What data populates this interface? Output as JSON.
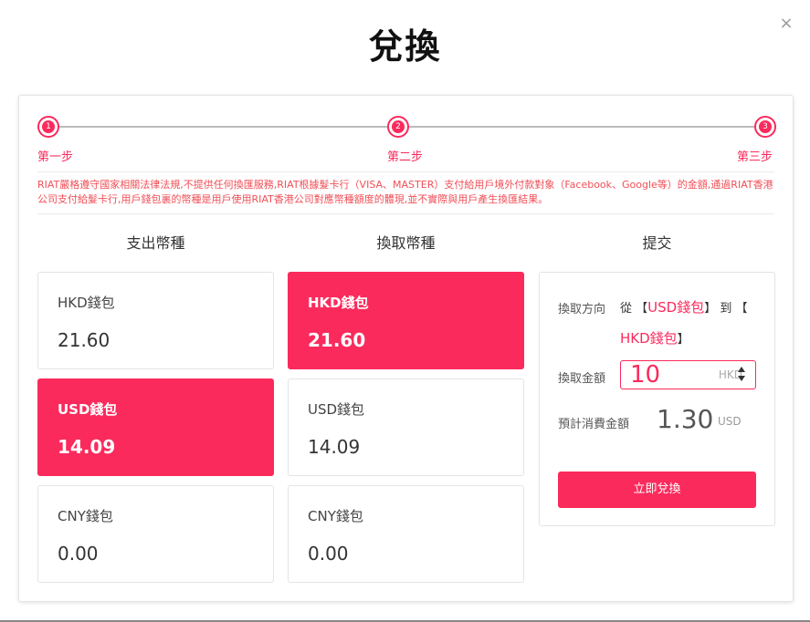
{
  "dialog": {
    "title": "兌換",
    "close_label": "×"
  },
  "stepper": {
    "steps": [
      {
        "number": "1",
        "label": "第一步"
      },
      {
        "number": "2",
        "label": "第二步"
      },
      {
        "number": "3",
        "label": "第三步"
      }
    ]
  },
  "notice": "RIAT嚴格遵守國家相關法律法規,不提供任何換匯服務,RIAT根據髮卡行（VISA、MASTER）支付給用戶境外付款對象（Facebook、Google等）的金額,通過RIAT香港公司支付給髮卡行,用戶錢包裏的幣種是用戶使用RIAT香港公司對應幣種額度的體現,並不實際與用戶產生換匯結果。",
  "columns": {
    "pay_title": "支出幣種",
    "receive_title": "換取幣種",
    "submit_title": "提交"
  },
  "pay_wallets": [
    {
      "name": "HKD錢包",
      "balance": "21.60",
      "selected": false
    },
    {
      "name": "USD錢包",
      "balance": "14.09",
      "selected": true
    },
    {
      "name": "CNY錢包",
      "balance": "0.00",
      "selected": false
    }
  ],
  "receive_wallets": [
    {
      "name": "HKD錢包",
      "balance": "21.60",
      "selected": true
    },
    {
      "name": "USD錢包",
      "balance": "14.09",
      "selected": false
    },
    {
      "name": "CNY錢包",
      "balance": "0.00",
      "selected": false
    }
  ],
  "submit": {
    "direction_label": "換取方向",
    "from_word": "從",
    "from_wallet": "USD錢包",
    "to_word": "到",
    "to_wallet": "HKD錢包",
    "bracket_open": "【",
    "bracket_close": "】",
    "amount_label": "換取金額",
    "amount_value": "10",
    "amount_currency": "HKD",
    "estimate_label": "預計消費金額",
    "estimate_value": "1.30",
    "estimate_currency": "USD",
    "button_label": "立即兌換"
  },
  "colors": {
    "accent": "#fb2a5c",
    "notice": "#f04f57"
  }
}
